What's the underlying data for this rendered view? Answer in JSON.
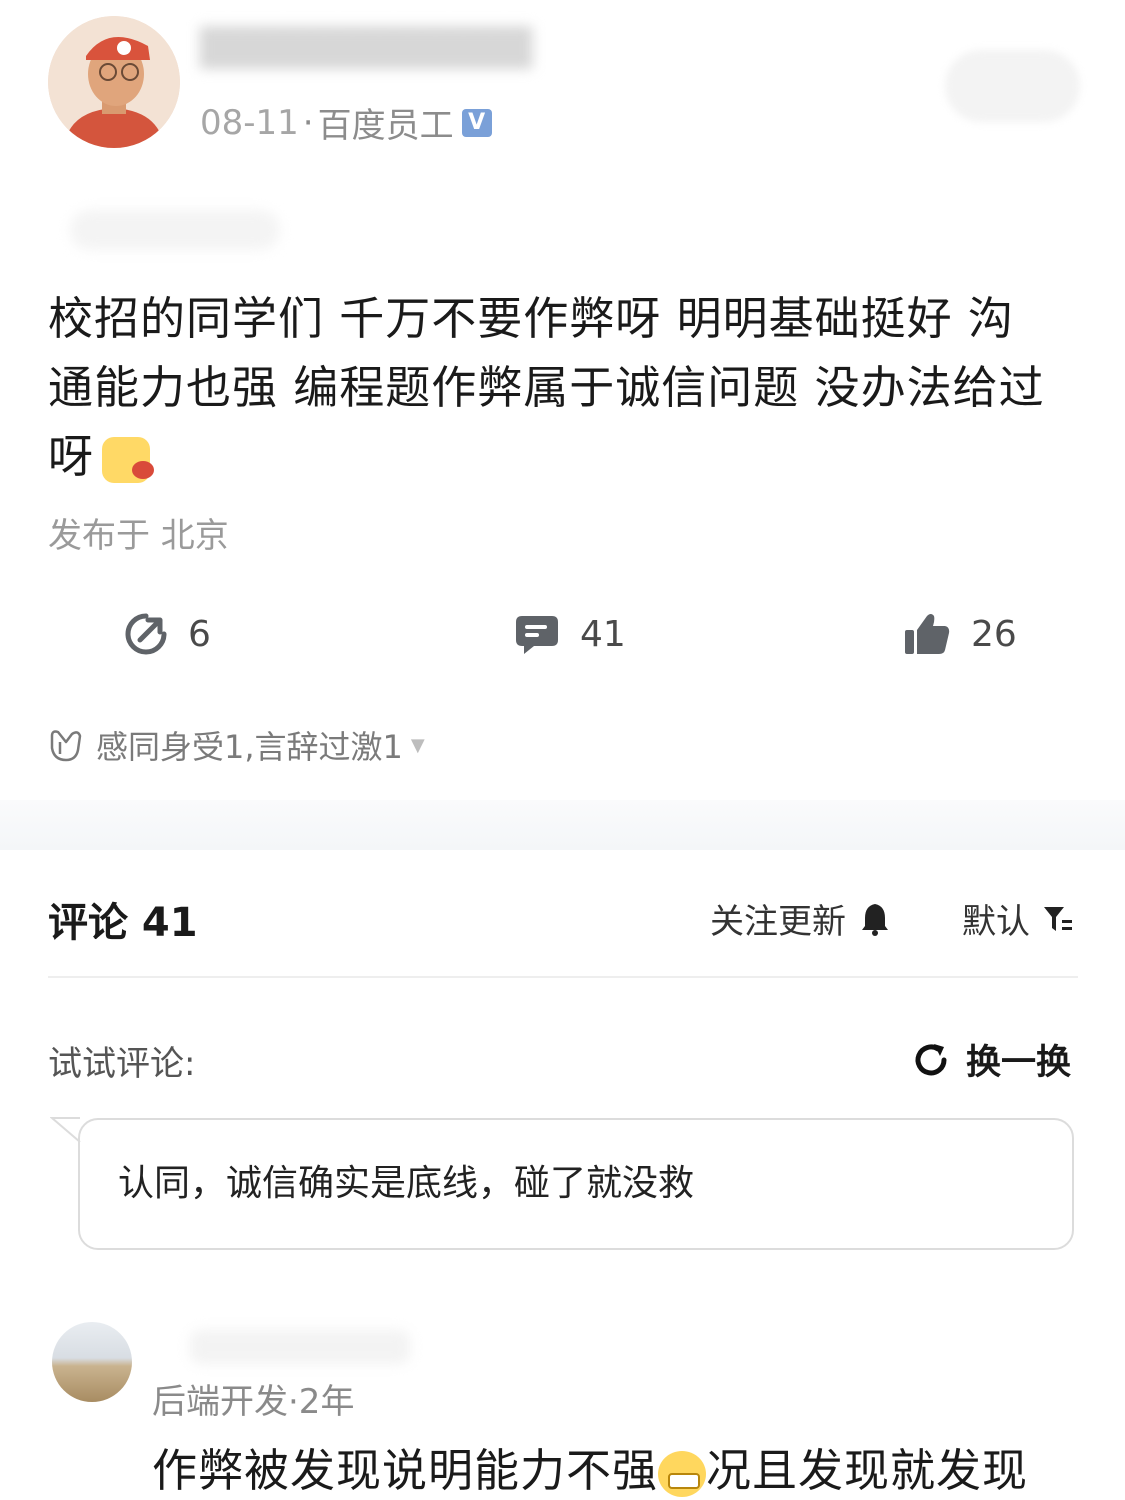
{
  "post": {
    "meta_date": "08-11",
    "meta_sep": "·",
    "author_title": "百度员工",
    "verified_icon": "verified-badge-icon",
    "text": "校招的同学们 千万不要作弊呀 明明基础挺好 沟通能力也强 编程题作弊属于诚信问题  没办法给过呀",
    "location": "发布于 北京"
  },
  "actions": {
    "share_count": "6",
    "comment_count": "41",
    "like_count": "26"
  },
  "reactions": {
    "text": "感同身受1,言辞过激1"
  },
  "comments_header": {
    "title": "评论 41",
    "follow_updates": "关注更新",
    "sort": "默认"
  },
  "suggestions": {
    "label": "试试评论:",
    "refresh": "换一换",
    "text": "认同，诚信确实是底线，碰了就没救"
  },
  "comment": {
    "meta": "后端开发·2年",
    "text_before": "作弊被发现说明能力不强",
    "text_after": "况且发现就发现"
  },
  "colors": {
    "accent_verified": "#7aa0d8",
    "icon_gray": "#5f6368"
  }
}
